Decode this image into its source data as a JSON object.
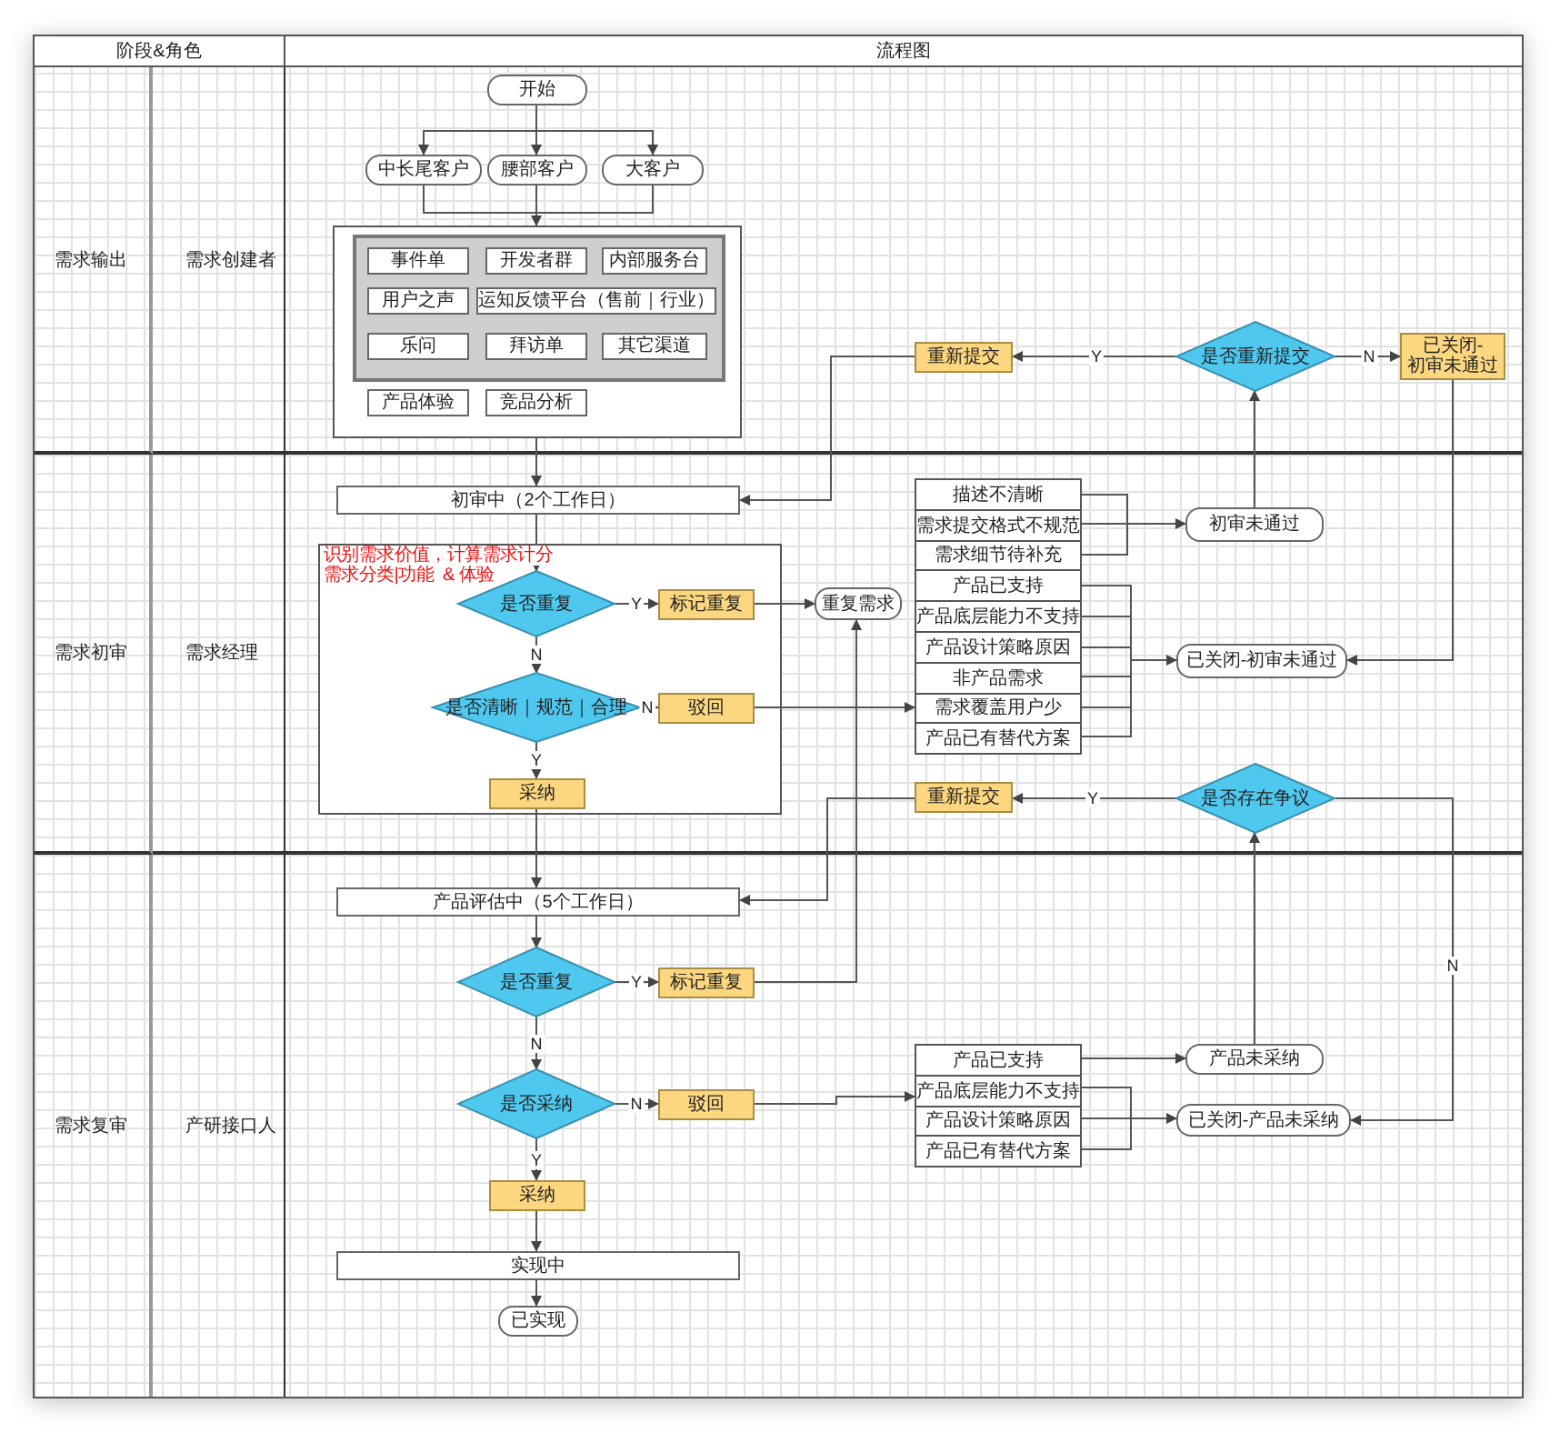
{
  "header": {
    "roles_column": "阶段&角色",
    "flow_column": "流程图"
  },
  "lanes": [
    {
      "stage": "需求输出",
      "role": "需求创建者"
    },
    {
      "stage": "需求初审",
      "role": "需求经理"
    },
    {
      "stage": "需求复审",
      "role": "产研接口人"
    }
  ],
  "nodes": [
    {
      "kind": "terminal",
      "text": "开始"
    },
    {
      "kind": "terminal",
      "text": "中长尾客户"
    },
    {
      "kind": "terminal",
      "text": "腰部客户"
    },
    {
      "kind": "terminal",
      "text": "大客户"
    },
    {
      "kind": "option",
      "text": "事件单"
    },
    {
      "kind": "option",
      "text": "开发者群"
    },
    {
      "kind": "option",
      "text": "内部服务台"
    },
    {
      "kind": "option",
      "text": "用户之声"
    },
    {
      "kind": "option",
      "text": "运知反馈平台（售前｜行业）"
    },
    {
      "kind": "option",
      "text": "乐问"
    },
    {
      "kind": "option",
      "text": "拜访单"
    },
    {
      "kind": "option",
      "text": "其它渠道"
    },
    {
      "kind": "option",
      "text": "产品体验"
    },
    {
      "kind": "option",
      "text": "竞品分析"
    },
    {
      "kind": "action",
      "text": "重新提交"
    },
    {
      "kind": "decision",
      "text": "是否重新提交"
    },
    {
      "kind": "action",
      "text": "已关闭-\n初审未通过"
    },
    {
      "kind": "terminal",
      "text": "初审未通过"
    },
    {
      "kind": "terminal",
      "text": "已关闭-初审未通过"
    },
    {
      "kind": "process",
      "text": "初审中（2个工作日）"
    },
    {
      "kind": "decision",
      "text": "是否重复"
    },
    {
      "kind": "action",
      "text": "标记重复"
    },
    {
      "kind": "terminal",
      "text": "重复需求"
    },
    {
      "kind": "decision",
      "text": "是否清晰｜规范｜合理"
    },
    {
      "kind": "action",
      "text": "驳回"
    },
    {
      "kind": "action",
      "text": "采纳"
    },
    {
      "kind": "action",
      "text": "重新提交"
    },
    {
      "kind": "decision",
      "text": "是否存在争议"
    },
    {
      "kind": "process",
      "text": "产品评估中（5个工作日）"
    },
    {
      "kind": "decision",
      "text": "是否重复"
    },
    {
      "kind": "action",
      "text": "标记重复"
    },
    {
      "kind": "decision",
      "text": "是否采纳"
    },
    {
      "kind": "action",
      "text": "驳回"
    },
    {
      "kind": "action",
      "text": "采纳"
    },
    {
      "kind": "process",
      "text": "实现中"
    },
    {
      "kind": "terminal",
      "text": "已实现"
    },
    {
      "kind": "terminal",
      "text": "产品未采纳"
    },
    {
      "kind": "terminal",
      "text": "已关闭-产品未采纳"
    }
  ],
  "note_lines": [
    "识别需求价值，计算需求计分",
    "需求分类|功能  & 体验"
  ],
  "reason_lists": [
    {
      "rows": [
        "描述不清晰",
        "需求提交格式不规范",
        "需求细节待补充",
        "产品已支持",
        "产品底层能力不支持",
        "产品设计策略原因",
        "非产品需求",
        "需求覆盖用户少",
        "产品已有替代方案"
      ]
    },
    {
      "rows": [
        "产品已支持",
        "产品底层能力不支持",
        "产品设计策略原因",
        "产品已有替代方案"
      ]
    }
  ],
  "edge_labels": [
    "Y",
    "N",
    "Y",
    "N",
    "N",
    "Y",
    "Y",
    "N",
    "Y",
    "N",
    "N",
    "Y"
  ]
}
